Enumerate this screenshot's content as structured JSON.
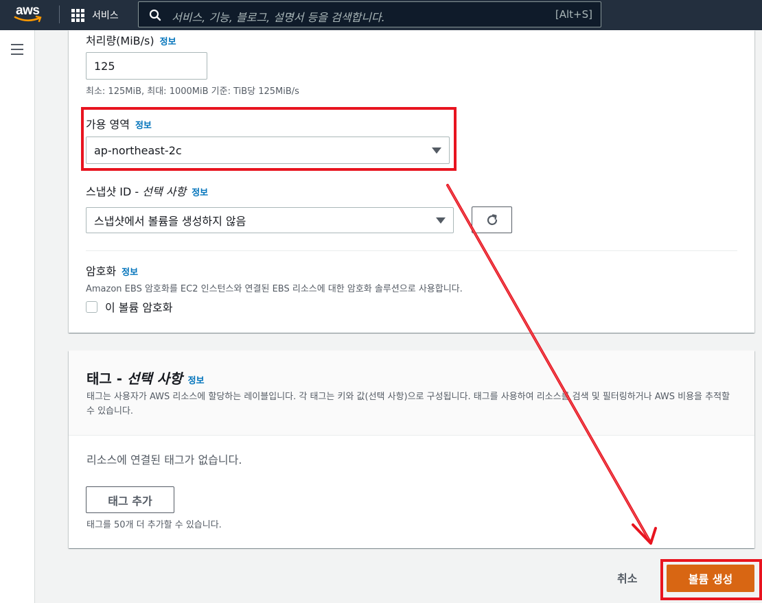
{
  "topnav": {
    "logo_text": "aws",
    "services_label": "서비스",
    "search_placeholder": "서비스, 기능, 블로그, 설명서 등을 검색합니다.",
    "search_shortcut": "[Alt+S]"
  },
  "form": {
    "info_link": "정보",
    "throughput": {
      "label": "처리량(MiB/s)",
      "value": "125",
      "hint": "최소: 125MiB, 최대: 1000MiB 기준: TiB당 125MiB/s"
    },
    "availability_zone": {
      "label": "가용 영역",
      "selected": "ap-northeast-2c"
    },
    "snapshot": {
      "label_main": "스냅샷 ID - ",
      "label_optional": "선택 사항",
      "selected": "스냅샷에서 볼륨을 생성하지 않음"
    },
    "encryption": {
      "label": "암호화",
      "description": "Amazon EBS 암호화를 EC2 인스턴스와 연결된 EBS 리소스에 대한 암호화 솔루션으로 사용합니다.",
      "checkbox_label": "이 볼륨 암호화",
      "checked": false
    }
  },
  "tags": {
    "title_main": "태그 - ",
    "title_optional": "선택 사항",
    "description": "태그는 사용자가 AWS 리소스에 할당하는 레이블입니다. 각 태그는 키와 값(선택 사항)으로 구성됩니다. 태그를 사용하여 리소스를 검색 및 필터링하거나 AWS 비용을 추적할 수 있습니다.",
    "empty_message": "리소스에 연결된 태그가 없습니다.",
    "add_button": "태그 추가",
    "limit_hint": "태그를 50개 더 추가할 수 있습니다."
  },
  "actions": {
    "cancel": "취소",
    "create": "볼륨 생성"
  },
  "colors": {
    "nav_bg": "#232f3e",
    "primary": "#d86613",
    "link": "#0073bb",
    "annotation": "#e8141f"
  }
}
